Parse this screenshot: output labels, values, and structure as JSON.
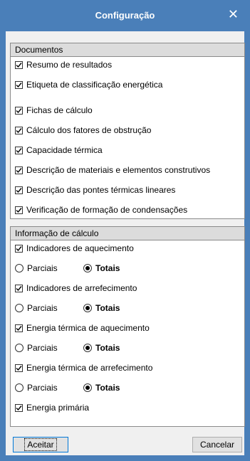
{
  "window": {
    "title": "Configuração",
    "close_icon": "close-icon"
  },
  "documentos": {
    "header": "Documentos",
    "items": [
      {
        "label": "Resumo de resultados",
        "checked": true
      },
      {
        "label": "Etiqueta de classificação energética",
        "checked": true
      },
      {
        "label": "Fichas de cálculo",
        "checked": true
      },
      {
        "label": "Cálculo dos fatores de obstrução",
        "checked": true
      },
      {
        "label": "Capacidade térmica",
        "checked": true
      },
      {
        "label": "Descrição de materiais e elementos construtivos",
        "checked": true
      },
      {
        "label": "Descrição das pontes térmicas lineares",
        "checked": true
      },
      {
        "label": "Verificação de formação de condensações",
        "checked": true
      }
    ]
  },
  "calculo": {
    "header": "Informação de cálculo",
    "items": [
      {
        "label": "Indicadores de aquecimento",
        "checked": true,
        "option_a": "Parciais",
        "option_b": "Totais",
        "selected": "Totais"
      },
      {
        "label": "Indicadores de arrefecimento",
        "checked": true,
        "option_a": "Parciais",
        "option_b": "Totais",
        "selected": "Totais"
      },
      {
        "label": "Energia térmica de aquecimento",
        "checked": true,
        "option_a": "Parciais",
        "option_b": "Totais",
        "selected": "Totais"
      },
      {
        "label": "Energia térmica de arrefecimento",
        "checked": true,
        "option_a": "Parciais",
        "option_b": "Totais",
        "selected": "Totais"
      },
      {
        "label": "Energia primária",
        "checked": true
      }
    ]
  },
  "buttons": {
    "accept": "Aceitar",
    "cancel": "Cancelar"
  },
  "colors": {
    "titlebar": "#4a7fb9",
    "dialog_bg": "#f0f0f0"
  }
}
